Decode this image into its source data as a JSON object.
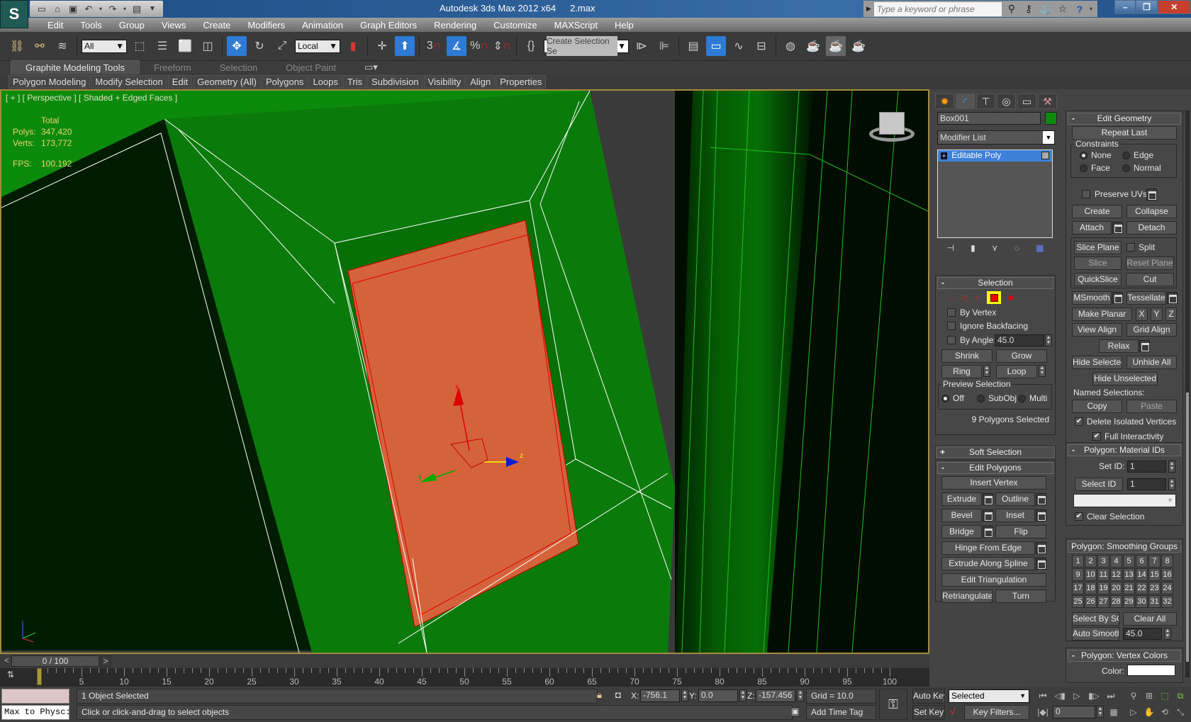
{
  "titlebar": {
    "app_name": "Autodesk 3ds Max  2012 x64",
    "file_name": "2.max",
    "search_placeholder": "Type a keyword or phrase",
    "app_button_glyph": "S"
  },
  "quick_access": [
    "new-icon",
    "open-icon",
    "save-icon",
    "undo-icon",
    "redo-icon",
    "project-folder-icon",
    "customize-dropdown-icon"
  ],
  "menu": [
    "Edit",
    "Tools",
    "Group",
    "Views",
    "Create",
    "Modifiers",
    "Animation",
    "Graph Editors",
    "Rendering",
    "Customize",
    "MAXScript",
    "Help"
  ],
  "main_toolbar": {
    "selection_filter": "All",
    "reference_coord": "Local",
    "named_selection": "Create Selection Se",
    "snap_label": "3",
    "active_tools": [
      "select-move",
      "angle-snap",
      "select-object-by-region",
      "scene-explorer"
    ]
  },
  "ribbon": {
    "tabs": [
      "Graphite Modeling Tools",
      "Freeform",
      "Selection",
      "Object Paint"
    ],
    "active_tab": "Graphite Modeling Tools",
    "panels": [
      "Polygon Modeling",
      "Modify Selection",
      "Edit",
      "Geometry (All)",
      "Polygons",
      "Loops",
      "Tris",
      "Subdivision",
      "Visibility",
      "Align",
      "Properties"
    ]
  },
  "viewport": {
    "label": "[ + ] [ Perspective ] [ Shaded + Edged Faces ]",
    "stats": {
      "header": "Total",
      "polys_label": "Polys:",
      "polys": "347,420",
      "verts_label": "Verts:",
      "verts": "173,772",
      "fps_label": "FPS:",
      "fps": "100.192"
    },
    "gizmo_axes": {
      "x": "x",
      "y": "y",
      "z": "z"
    },
    "colors": {
      "selected_face": "#d4623a",
      "mesh": "#0b7a0b",
      "background": "#001800"
    }
  },
  "command_panel": {
    "tabs": [
      "create-icon",
      "modify-icon",
      "hierarchy-icon",
      "motion-icon",
      "display-icon",
      "utilities-icon"
    ],
    "active_tab": "modify-icon",
    "object_name": "Box001",
    "object_color": "#0b8a0b",
    "modifier_list": "Modifier List",
    "stack": [
      {
        "label": "Editable Poly",
        "expander": "+"
      }
    ],
    "selection": {
      "title": "Selection",
      "by_vertex": "By Vertex",
      "ignore_backfacing": "Ignore Backfacing",
      "by_angle": "By Angle:",
      "angle_value": "45.0",
      "shrink": "Shrink",
      "grow": "Grow",
      "ring": "Ring",
      "loop": "Loop",
      "preview_selection": "Preview Selection",
      "preview_options": [
        "Off",
        "SubObj",
        "Multi"
      ],
      "preview_selected": "Off",
      "status": "9 Polygons Selected",
      "subobject_level": "Polygon"
    },
    "soft_selection": {
      "title": "Soft Selection",
      "expander": "+"
    },
    "edit_polygons": {
      "title": "Edit Polygons",
      "insert_vertex": "Insert Vertex",
      "extrude": "Extrude",
      "outline": "Outline",
      "bevel": "Bevel",
      "inset": "Inset",
      "bridge": "Bridge",
      "flip": "Flip",
      "hinge": "Hinge From Edge",
      "extrude_spline": "Extrude Along Spline",
      "edit_tri": "Edit Triangulation",
      "retriangulate": "Retriangulate",
      "turn": "Turn"
    },
    "edit_geometry": {
      "title": "Edit Geometry",
      "repeat_last": "Repeat Last",
      "constraints": "Constraints",
      "constraint_options": [
        "None",
        "Edge",
        "Face",
        "Normal"
      ],
      "constraint_selected": "None",
      "preserve_uvs": "Preserve UVs",
      "create": "Create",
      "collapse": "Collapse",
      "attach": "Attach",
      "detach": "Detach",
      "slice_plane": "Slice Plane",
      "split": "Split",
      "slice": "Slice",
      "reset_plane": "Reset Plane",
      "quickslice": "QuickSlice",
      "cut": "Cut",
      "msmooth": "MSmooth",
      "tessellate": "Tessellate",
      "make_planar": "Make Planar",
      "x": "X",
      "y": "Y",
      "z": "Z",
      "view_align": "View Align",
      "grid_align": "Grid Align",
      "relax": "Relax",
      "hide_selected": "Hide Selected",
      "unhide_all": "Unhide All",
      "hide_unselected": "Hide Unselected",
      "named_selections": "Named Selections:",
      "copy": "Copy",
      "paste": "Paste",
      "delete_isolated": "Delete Isolated Vertices",
      "full_interactivity": "Full Interactivity"
    },
    "material_ids": {
      "title": "Polygon: Material IDs",
      "set_id_label": "Set ID:",
      "set_id": "1",
      "select_id": "Select ID",
      "select_id_value": "1",
      "clear_selection": "Clear Selection"
    },
    "smoothing_groups": {
      "title": "Polygon: Smoothing Groups",
      "groups": [
        "1",
        "2",
        "3",
        "4",
        "5",
        "6",
        "7",
        "8",
        "9",
        "10",
        "11",
        "12",
        "13",
        "14",
        "15",
        "16",
        "17",
        "18",
        "19",
        "20",
        "21",
        "22",
        "23",
        "24",
        "25",
        "26",
        "27",
        "28",
        "29",
        "30",
        "31",
        "32"
      ],
      "select_by_sg": "Select By SG",
      "clear_all": "Clear All",
      "auto_smooth": "Auto Smooth",
      "auto_smooth_value": "45.0"
    },
    "vertex_colors": {
      "title": "Polygon: Vertex Colors",
      "color_label": "Color:",
      "color": "#ffffff"
    }
  },
  "timeline": {
    "frame_display": "0 / 100",
    "prev": "<",
    "next": ">",
    "current_frame": 0,
    "start": 0,
    "end": 100,
    "labels": [
      "0",
      "5",
      "10",
      "15",
      "20",
      "25",
      "30",
      "35",
      "40",
      "45",
      "50",
      "55",
      "60",
      "65",
      "70",
      "75",
      "80",
      "85",
      "90",
      "95",
      "100"
    ]
  },
  "status": {
    "maxscript_line": "Max to Physc:",
    "selected_count": "1 Object Selected",
    "prompt": "Click or click-and-drag to select objects",
    "x_label": "X:",
    "x": "-756.1",
    "y_label": "Y:",
    "y": "0.0",
    "z_label": "Z:",
    "z": "-157.456",
    "grid": "Grid = 10.0",
    "add_time_tag": "Add Time Tag",
    "auto_key": "Auto Key",
    "set_key": "Set Key",
    "key_mode": "Selected",
    "key_filters": "Key Filters...",
    "frame_field": "0"
  }
}
